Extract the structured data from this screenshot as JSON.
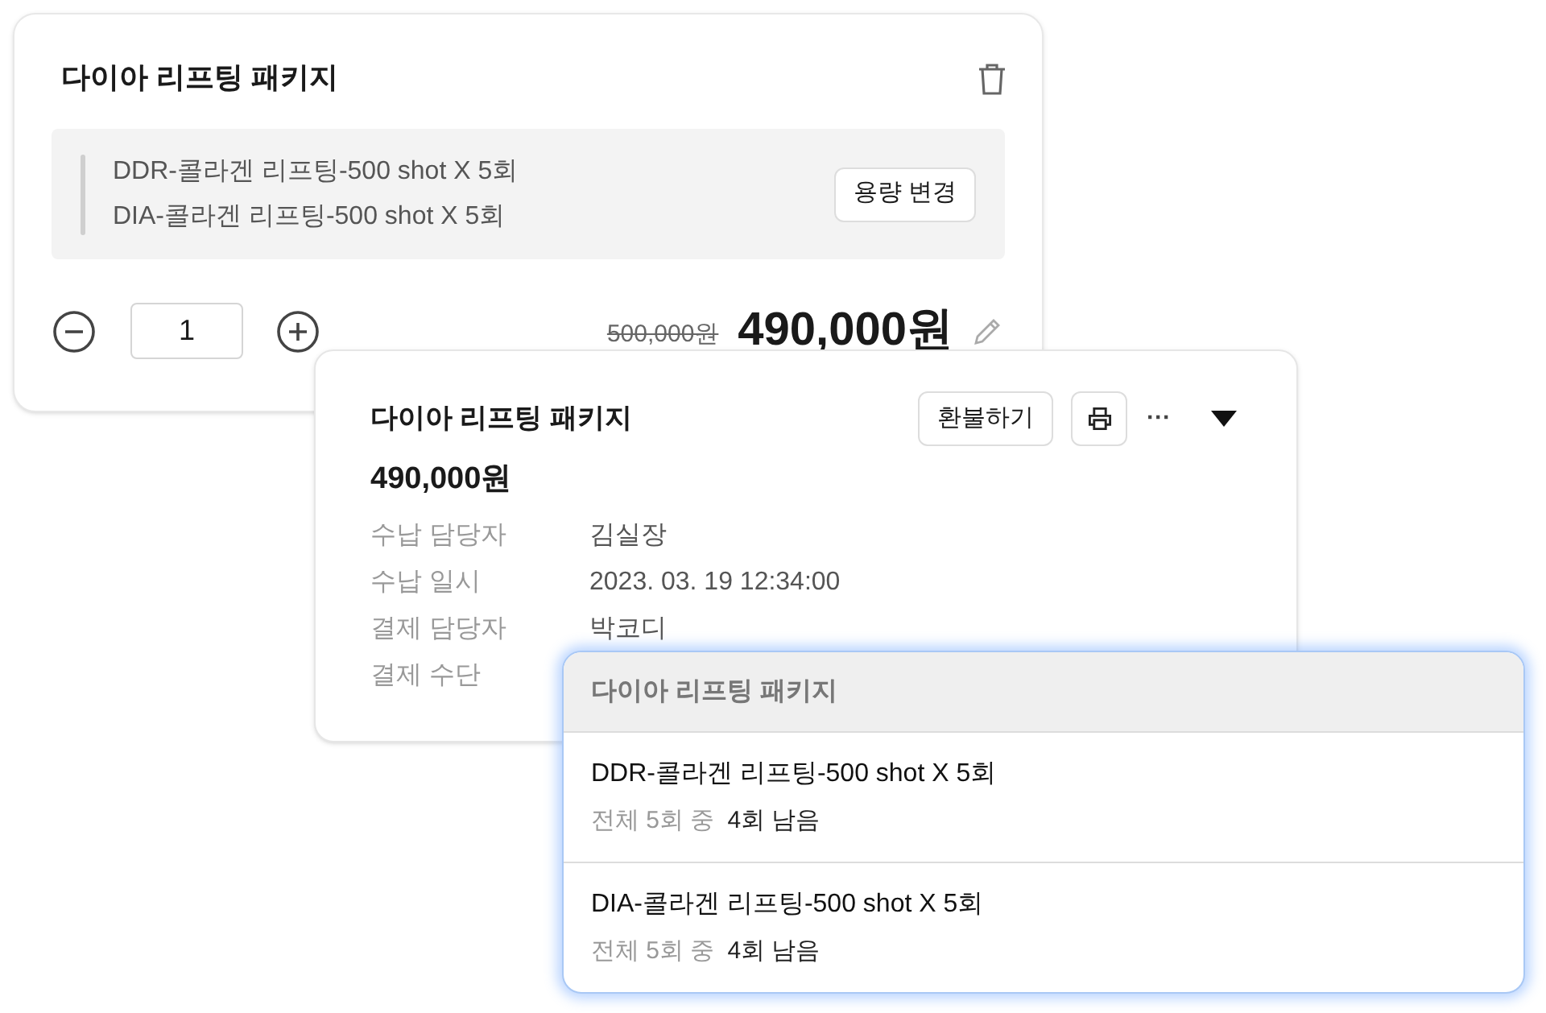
{
  "cart_card": {
    "title": "다이아 리프팅 패키지",
    "items": [
      "DDR-콜라겐 리프팅-500 shot X 5회",
      "DIA-콜라겐 리프팅-500 shot X 5회"
    ],
    "change_button": "용량 변경",
    "quantity": "1",
    "original_price": "500,000원",
    "price": "490,000원"
  },
  "payment_card": {
    "title": "다이아 리프팅 패키지",
    "refund_button": "환불하기",
    "more_button": "···",
    "expanded": true,
    "amount": "490,000원",
    "details": [
      {
        "label": "수납 담당자",
        "value": "김실장"
      },
      {
        "label": "수납 일시",
        "value": "2023. 03. 19 12:34:00"
      },
      {
        "label": "결제 담당자",
        "value": "박코디"
      },
      {
        "label": "결제 수단"
      }
    ]
  },
  "dropdown": {
    "header": "다이아 리프팅 패키지",
    "items": [
      {
        "name": "DDR-콜라겐 리프팅-500 shot X 5회",
        "total": "전체 5회 중",
        "remaining": "4회 남음"
      },
      {
        "name": "DIA-콜라겐 리프팅-500 shot X 5회",
        "total": "전체 5회 중",
        "remaining": "4회 남음"
      }
    ]
  }
}
